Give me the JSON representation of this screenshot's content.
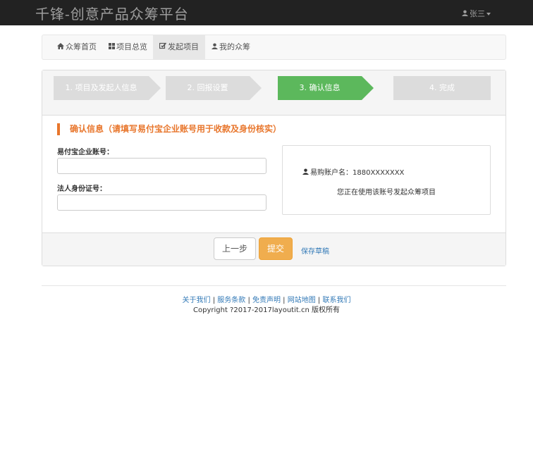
{
  "header": {
    "brand": "千锋-创意产品众筹平台",
    "user_name": "张三"
  },
  "tabs": [
    {
      "label": "众筹首页",
      "icon": "home-icon"
    },
    {
      "label": "项目总览",
      "icon": "grid-icon"
    },
    {
      "label": "发起项目",
      "icon": "edit-icon",
      "active": true
    },
    {
      "label": "我的众筹",
      "icon": "user-icon"
    }
  ],
  "steps": [
    {
      "label": "1. 项目及发起人信息"
    },
    {
      "label": "2. 回报设置"
    },
    {
      "label": "3. 确认信息",
      "active": true
    },
    {
      "label": "4. 完成"
    }
  ],
  "form": {
    "section_title": "确认信息（请填写易付宝企业账号用于收款及身份核实）",
    "alipay_label": "易付宝企业账号：",
    "alipay_value": "",
    "id_label": "法人身份证号：",
    "id_value": ""
  },
  "info": {
    "account_text": "易购账户名：1880XXXXXXX",
    "note": "您正在使用该账号发起众筹项目"
  },
  "actions": {
    "prev": "上一步",
    "submit": "提交",
    "save": "保存草稿"
  },
  "footer": {
    "links": [
      "关于我们",
      "服务条款",
      "免责声明",
      "网站地图",
      "联系我们"
    ],
    "copyright": "Copyright ?2017-2017layoutit.cn 版权所有"
  },
  "colors": {
    "accent": "#e8762c",
    "step_active": "#5cb85c",
    "submit": "#f0ad4e"
  }
}
